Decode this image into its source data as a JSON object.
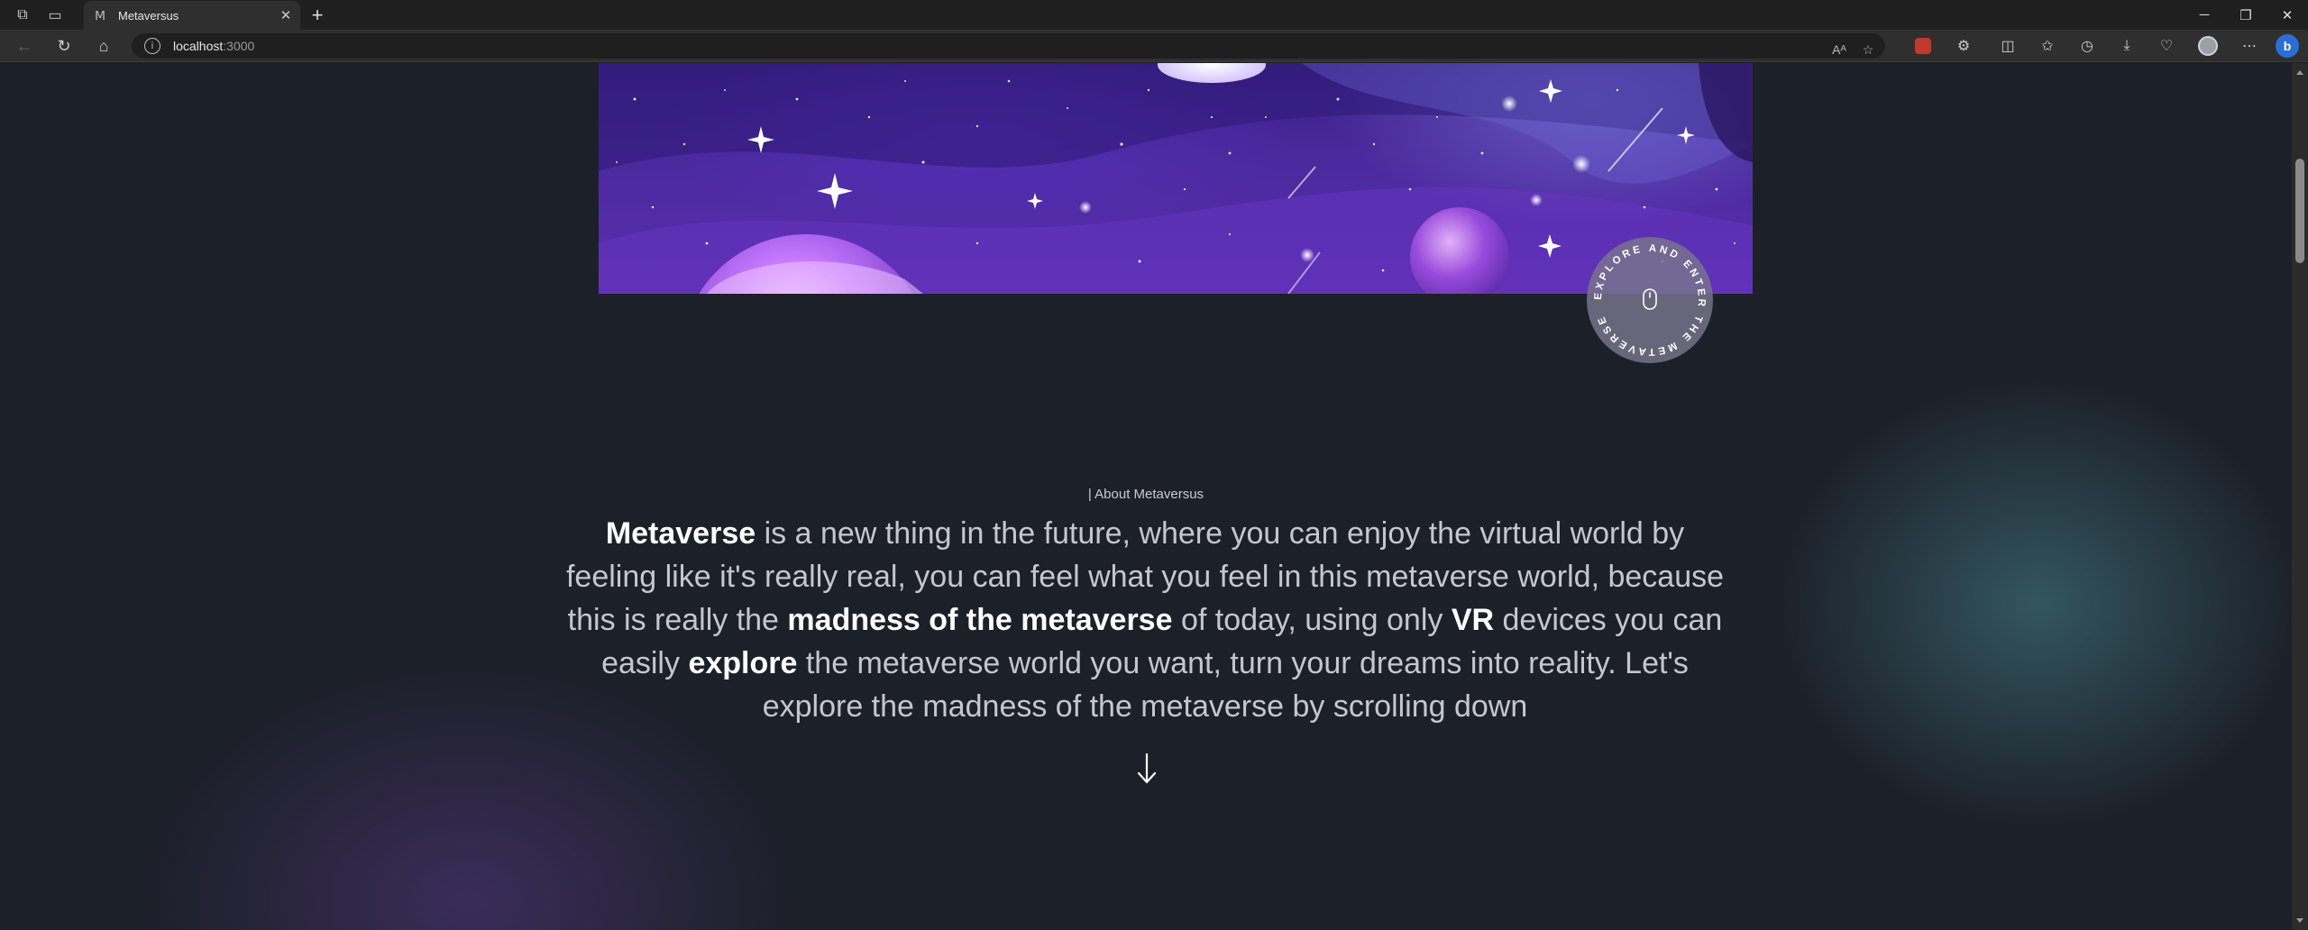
{
  "browser": {
    "tab": {
      "title": "Metaversus",
      "favicon": "metaversus-favicon"
    },
    "address": {
      "host": "localhost",
      "port": ":3000"
    }
  },
  "hero": {
    "badge_text": "EXPLORE AND ENTER THE METAVERSE"
  },
  "about": {
    "label": "| About Metaversus",
    "segments": [
      {
        "text": "Metaverse",
        "bold": true
      },
      {
        "text": " is a new thing in the future, where you can enjoy the virtual world by feeling like it's really real, you can feel what you feel in this metaverse world, because this is really the ",
        "bold": false
      },
      {
        "text": "madness of the metaverse",
        "bold": true
      },
      {
        "text": " of today, using only ",
        "bold": false
      },
      {
        "text": "VR",
        "bold": true
      },
      {
        "text": " devices you can easily ",
        "bold": false
      },
      {
        "text": "explore",
        "bold": true
      },
      {
        "text": " the metaverse world you want, turn your dreams into reality. Let's explore the madness of the metaverse by scrolling down",
        "bold": false
      }
    ]
  },
  "colors": {
    "page_bg": "#1c2028",
    "hero_purple": "#4b2a9e",
    "accent_teal": "#46828c"
  }
}
